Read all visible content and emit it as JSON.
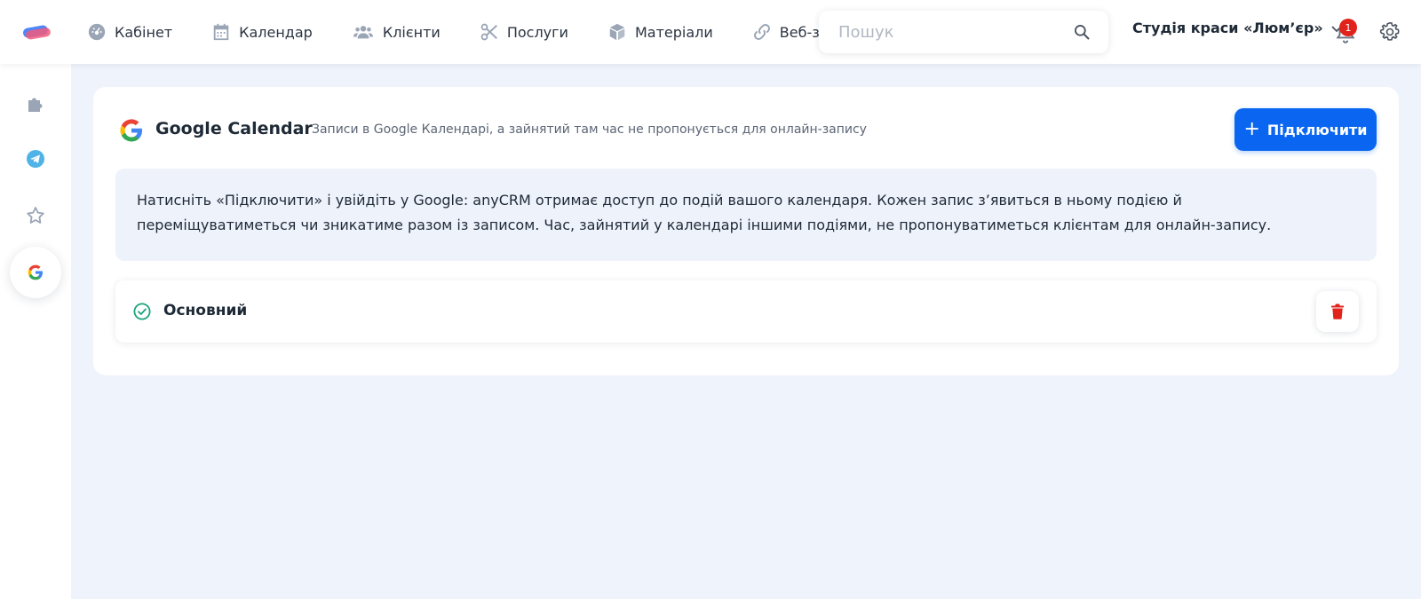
{
  "nav": {
    "items": [
      {
        "label": "Кабінет",
        "icon": "dashboard-icon"
      },
      {
        "label": "Календар",
        "icon": "calendar-icon"
      },
      {
        "label": "Клієнти",
        "icon": "users-icon"
      },
      {
        "label": "Послуги",
        "icon": "scissors-icon"
      },
      {
        "label": "Матеріали",
        "icon": "box-icon"
      },
      {
        "label": "Веб-заст",
        "icon": "link-icon"
      }
    ]
  },
  "search": {
    "placeholder": "Пошук"
  },
  "studio": {
    "name": "Студія краси «Люм’єр»"
  },
  "notifications": {
    "count": "1"
  },
  "sidebar": {
    "items": [
      {
        "icon": "puzzle-icon",
        "active": false
      },
      {
        "icon": "telegram-icon",
        "active": false
      },
      {
        "icon": "star-icon",
        "active": false
      },
      {
        "icon": "google-icon",
        "active": true
      }
    ]
  },
  "integration": {
    "title": "Google Calendar",
    "subtitle": "Записи в Google Календарі, а зайнятий там час не пропонується для онлайн-запису",
    "connect_label": "Підключити",
    "info_line1": "Натисніть «Підключити» і увійдіть у Google: anyCRM отримає доступ до подій вашого календаря. Кожен запис з’явиться в ньому подією й",
    "info_line2": "переміщуватиметься чи зникатиме разом із записом. Час, зайнятий у календарі іншими подіями, не пропонуватиметься клієнтам для онлайн-запису."
  },
  "calendars": [
    {
      "name": "Основний",
      "status": "connected"
    }
  ],
  "colors": {
    "accent": "#0a66f0",
    "danger": "#e0241b",
    "success": "#1aa37a",
    "background": "#eff3fb"
  }
}
